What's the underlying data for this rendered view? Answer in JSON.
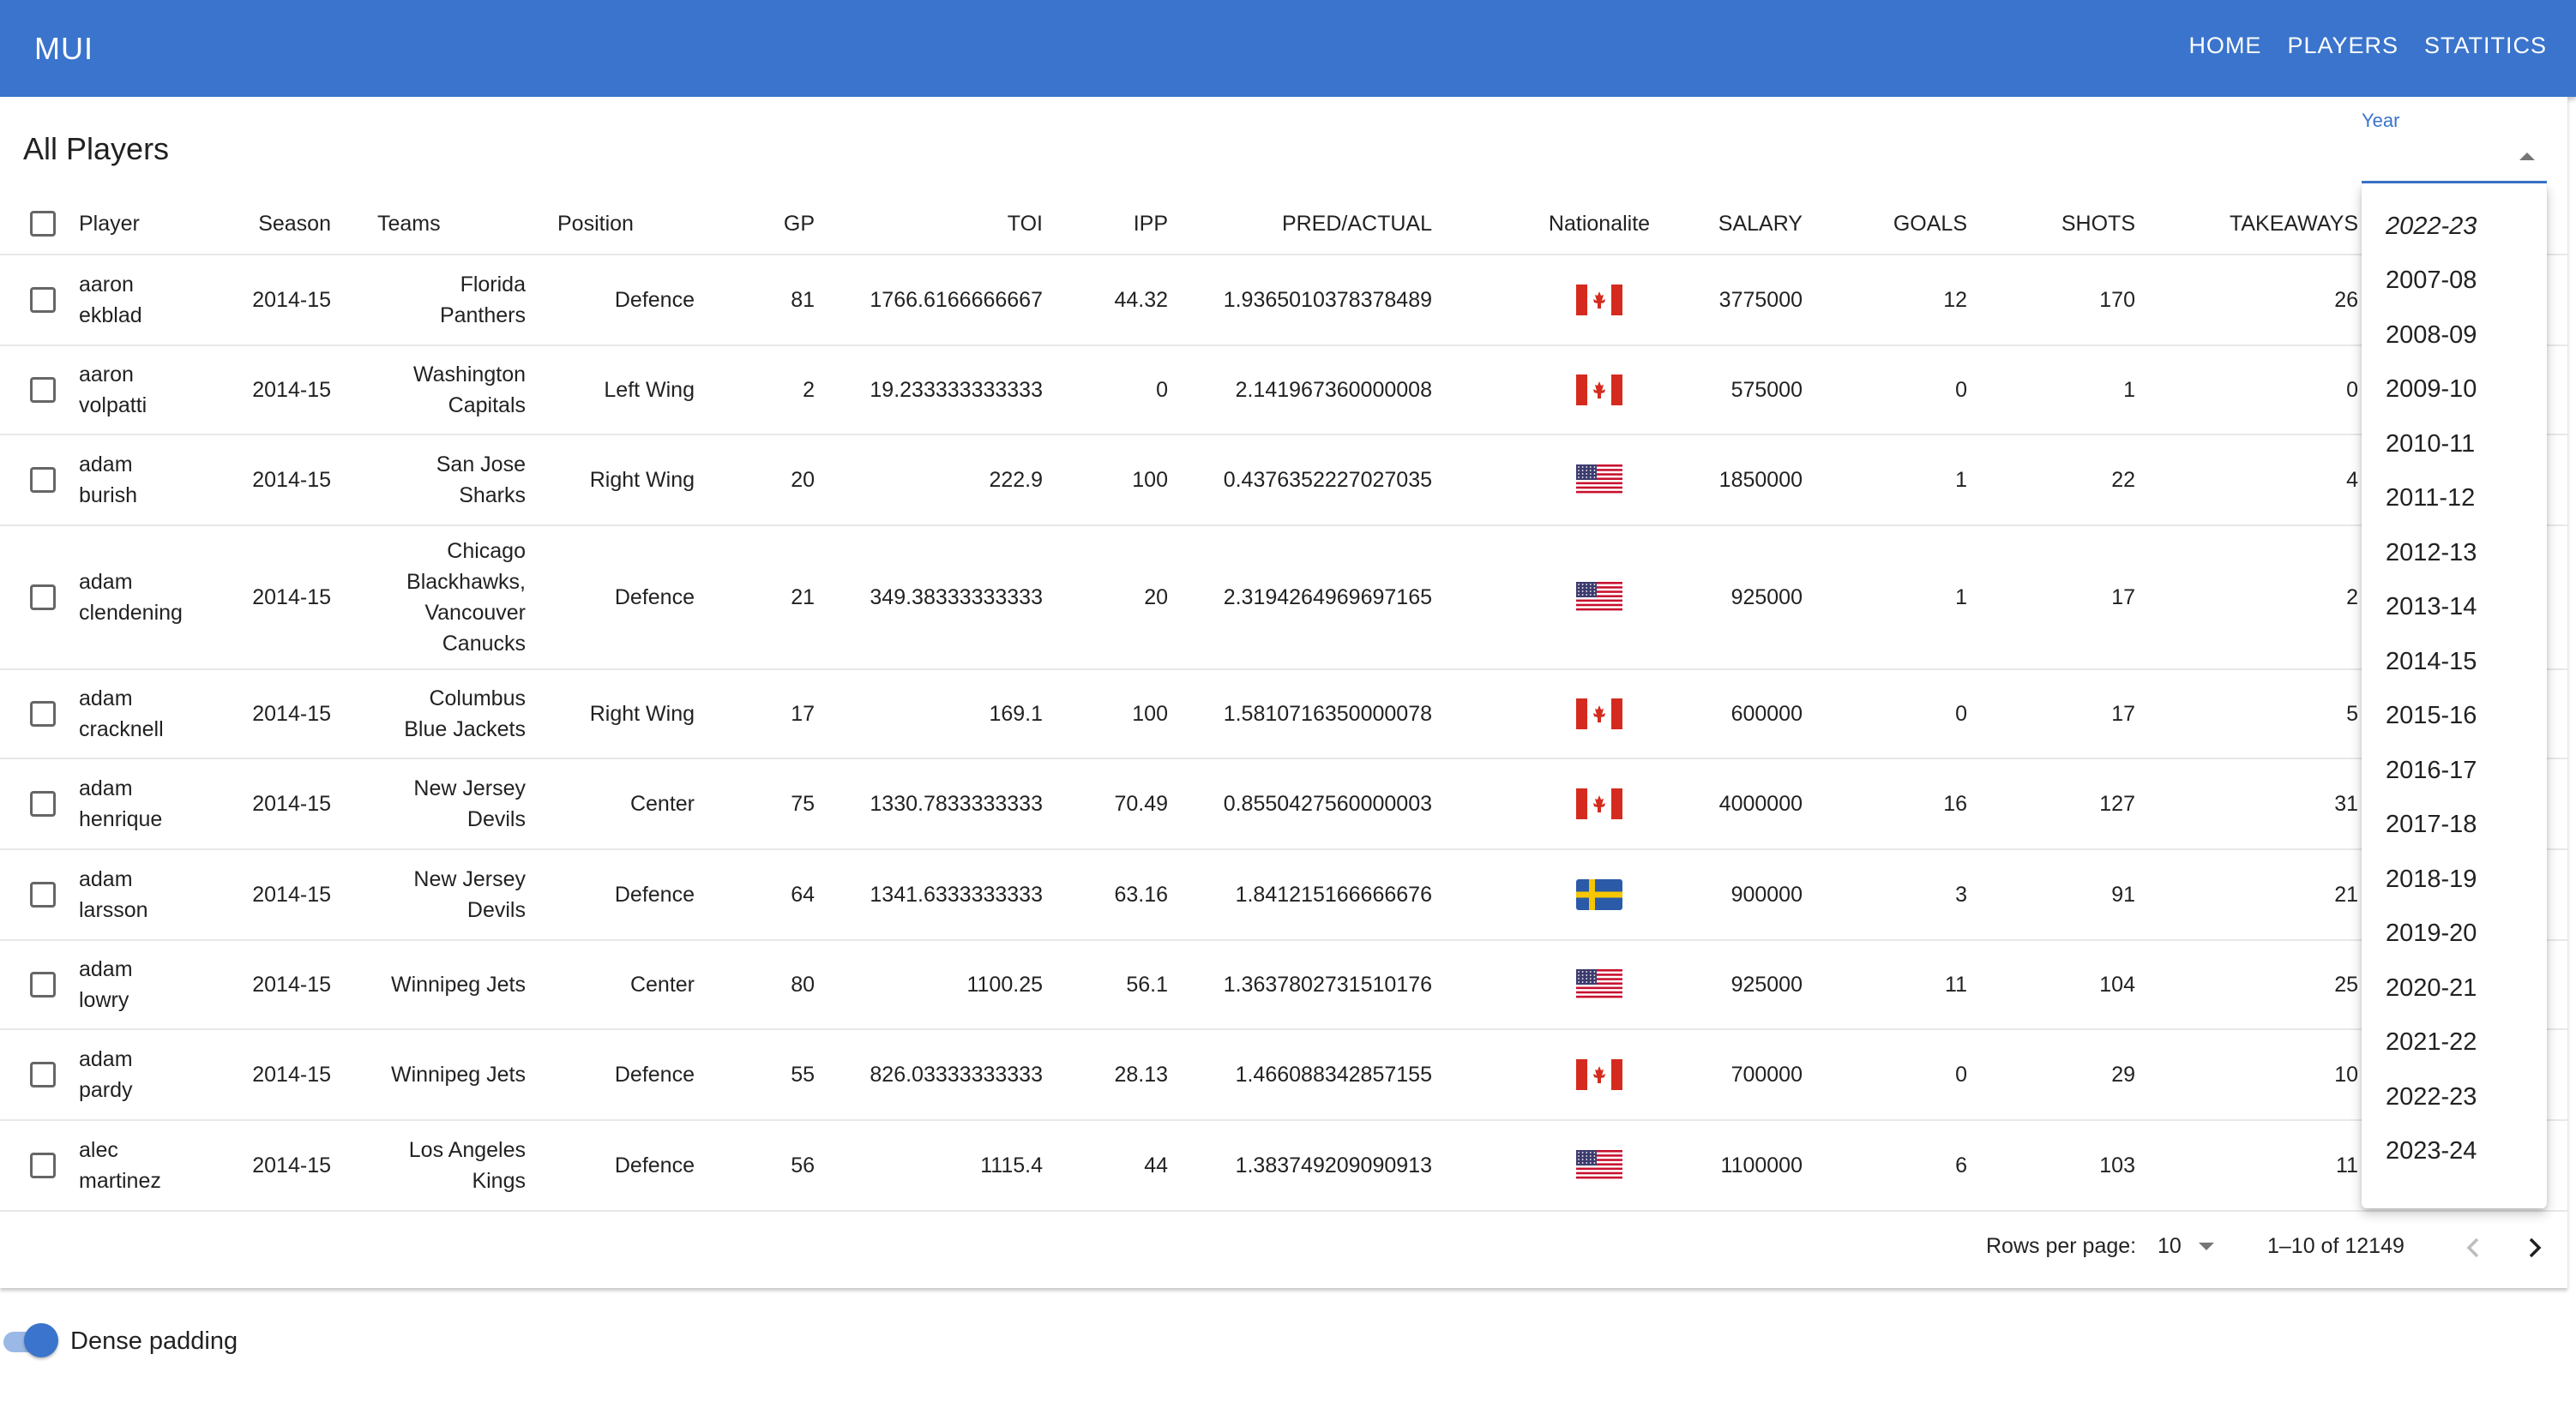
{
  "app": {
    "brand": "MUI"
  },
  "nav": {
    "items": [
      "HOME",
      "PLAYERS",
      "STATITICS"
    ]
  },
  "page": {
    "title": "All Players"
  },
  "year_filter": {
    "label": "Year",
    "options": [
      "2022-23",
      "2007-08",
      "2008-09",
      "2009-10",
      "2010-11",
      "2011-12",
      "2012-13",
      "2013-14",
      "2014-15",
      "2015-16",
      "2016-17",
      "2017-18",
      "2018-19",
      "2019-20",
      "2020-21",
      "2021-22",
      "2022-23",
      "2023-24"
    ]
  },
  "table": {
    "columns": [
      "Player",
      "Season",
      "Teams",
      "Position",
      "GP",
      "TOI",
      "IPP",
      "PRED/ACTUAL",
      "Nationalite",
      "SALARY",
      "GOALS",
      "SHOTS",
      "TAKEAWAYS"
    ],
    "rows": [
      {
        "player": [
          "aaron",
          "ekblad"
        ],
        "season": "2014-15",
        "teams": [
          "Florida",
          "Panthers"
        ],
        "position": "Defence",
        "gp": "81",
        "toi": "1766.6166666667",
        "ipp": "44.32",
        "pred_actual": "1.9365010378378489",
        "nationality": "canada",
        "salary": "3775000",
        "goals": "12",
        "shots": "170",
        "takeaways": "26"
      },
      {
        "player": [
          "aaron",
          "volpatti"
        ],
        "season": "2014-15",
        "teams": [
          "Washington",
          "Capitals"
        ],
        "position": "Left Wing",
        "gp": "2",
        "toi": "19.233333333333",
        "ipp": "0",
        "pred_actual": "2.141967360000008",
        "nationality": "canada",
        "salary": "575000",
        "goals": "0",
        "shots": "1",
        "takeaways": "0"
      },
      {
        "player": [
          "adam",
          "burish"
        ],
        "season": "2014-15",
        "teams": [
          "San Jose",
          "Sharks"
        ],
        "position": "Right Wing",
        "gp": "20",
        "toi": "222.9",
        "ipp": "100",
        "pred_actual": "0.4376352227027035",
        "nationality": "usa",
        "salary": "1850000",
        "goals": "1",
        "shots": "22",
        "takeaways": "4"
      },
      {
        "player": [
          "adam",
          "clendening"
        ],
        "season": "2014-15",
        "teams": [
          "Chicago",
          "Blackhawks,",
          "Vancouver",
          "Canucks"
        ],
        "position": "Defence",
        "gp": "21",
        "toi": "349.38333333333",
        "ipp": "20",
        "pred_actual": "2.3194264969697165",
        "nationality": "usa",
        "salary": "925000",
        "goals": "1",
        "shots": "17",
        "takeaways": "2"
      },
      {
        "player": [
          "adam",
          "cracknell"
        ],
        "season": "2014-15",
        "teams": [
          "Columbus",
          "Blue Jackets"
        ],
        "position": "Right Wing",
        "gp": "17",
        "toi": "169.1",
        "ipp": "100",
        "pred_actual": "1.5810716350000078",
        "nationality": "canada",
        "salary": "600000",
        "goals": "0",
        "shots": "17",
        "takeaways": "5"
      },
      {
        "player": [
          "adam",
          "henrique"
        ],
        "season": "2014-15",
        "teams": [
          "New Jersey",
          "Devils"
        ],
        "position": "Center",
        "gp": "75",
        "toi": "1330.7833333333",
        "ipp": "70.49",
        "pred_actual": "0.8550427560000003",
        "nationality": "canada",
        "salary": "4000000",
        "goals": "16",
        "shots": "127",
        "takeaways": "31"
      },
      {
        "player": [
          "adam",
          "larsson"
        ],
        "season": "2014-15",
        "teams": [
          "New Jersey",
          "Devils"
        ],
        "position": "Defence",
        "gp": "64",
        "toi": "1341.6333333333",
        "ipp": "63.16",
        "pred_actual": "1.841215166666676",
        "nationality": "sweden",
        "salary": "900000",
        "goals": "3",
        "shots": "91",
        "takeaways": "21"
      },
      {
        "player": [
          "adam",
          "lowry"
        ],
        "season": "2014-15",
        "teams": [
          "Winnipeg Jets"
        ],
        "position": "Center",
        "gp": "80",
        "toi": "1100.25",
        "ipp": "56.1",
        "pred_actual": "1.3637802731510176",
        "nationality": "usa",
        "salary": "925000",
        "goals": "11",
        "shots": "104",
        "takeaways": "25"
      },
      {
        "player": [
          "adam",
          "pardy"
        ],
        "season": "2014-15",
        "teams": [
          "Winnipeg Jets"
        ],
        "position": "Defence",
        "gp": "55",
        "toi": "826.03333333333",
        "ipp": "28.13",
        "pred_actual": "1.466088342857155",
        "nationality": "canada",
        "salary": "700000",
        "goals": "0",
        "shots": "29",
        "takeaways": "10"
      },
      {
        "player": [
          "alec",
          "martinez"
        ],
        "season": "2014-15",
        "teams": [
          "Los Angeles",
          "Kings"
        ],
        "position": "Defence",
        "gp": "56",
        "toi": "1115.4",
        "ipp": "44",
        "pred_actual": "1.383749209090913",
        "nationality": "usa",
        "salary": "1100000",
        "goals": "6",
        "shots": "103",
        "takeaways": "11"
      }
    ]
  },
  "pagination": {
    "rows_per_page_label": "Rows per page:",
    "rows_per_page": "10",
    "range": "1–10 of 12149"
  },
  "dense_padding": {
    "label": "Dense padding",
    "enabled": true
  },
  "colors": {
    "primary": "#3a74cc",
    "switch_track": "#9bb9e6"
  }
}
